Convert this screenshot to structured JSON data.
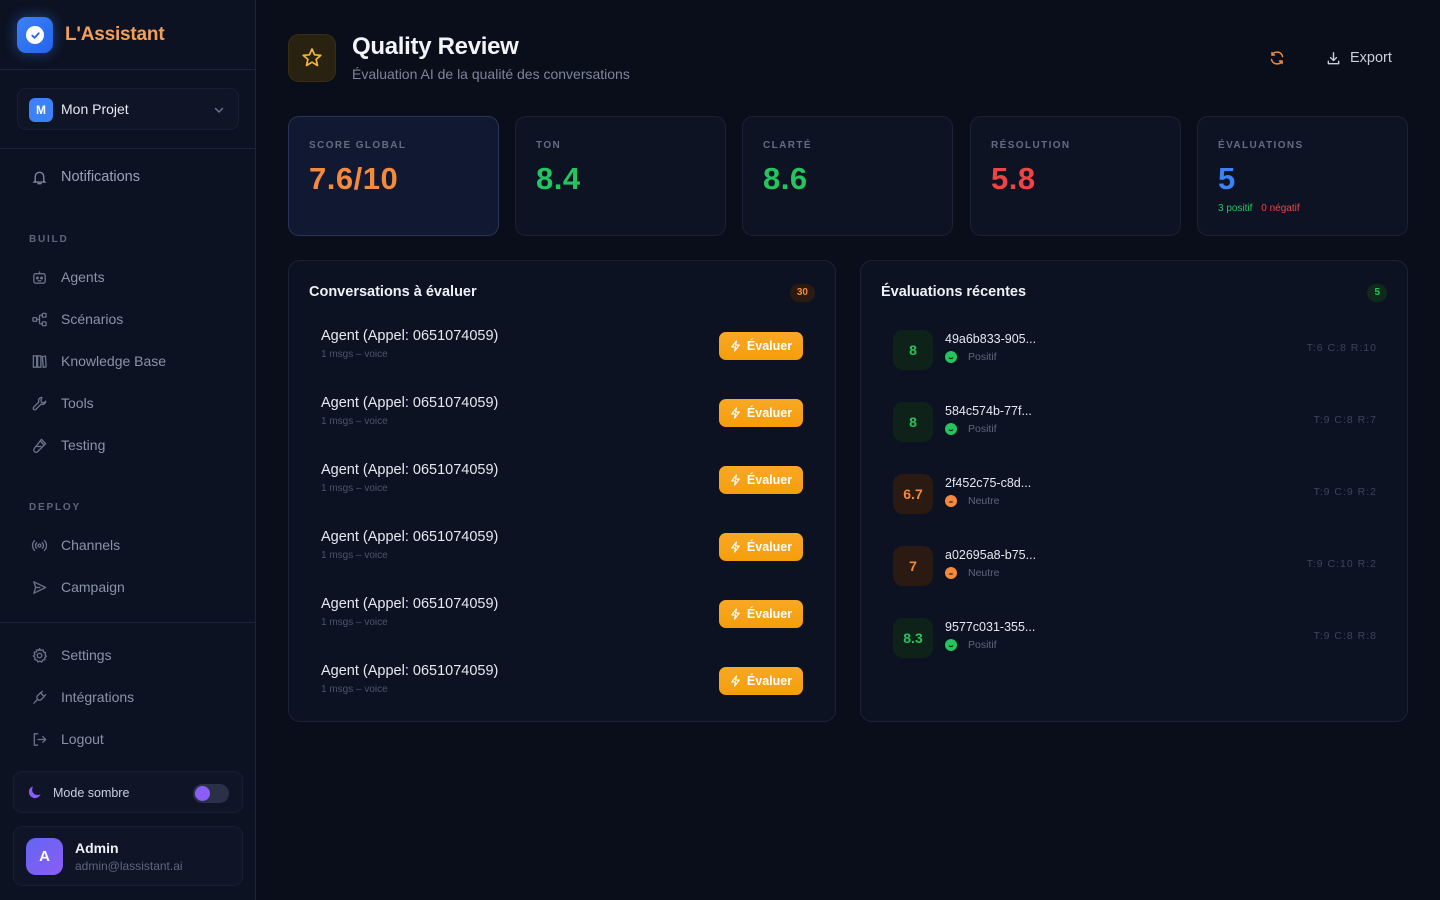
{
  "brand": {
    "name": "L'Assistant"
  },
  "project": {
    "badge": "M",
    "name": "Mon Projet"
  },
  "nav": {
    "notifications": "Notifications",
    "build_label": "BUILD",
    "build": [
      "Agents",
      "Scénarios",
      "Knowledge Base",
      "Tools",
      "Testing"
    ],
    "deploy_label": "DEPLOY",
    "deploy": [
      "Channels",
      "Campaign"
    ],
    "bottom": [
      "Settings",
      "Intégrations",
      "Logout"
    ]
  },
  "mode": {
    "label": "Mode sombre",
    "enabled": true
  },
  "user": {
    "initial": "A",
    "name": "Admin",
    "email": "admin@lassistant.ai"
  },
  "header": {
    "title": "Quality Review",
    "subtitle": "Évaluation AI de la qualité des conversations",
    "export_label": "Export"
  },
  "stats": [
    {
      "label": "SCORE GLOBAL",
      "value": "7.6/10",
      "color": "#f58a3c"
    },
    {
      "label": "TON",
      "value": "8.4",
      "color": "#22c55e"
    },
    {
      "label": "CLARTÉ",
      "value": "8.6",
      "color": "#22c55e"
    },
    {
      "label": "RÉSOLUTION",
      "value": "5.8",
      "color": "#ef4444"
    },
    {
      "label": "ÉVALUATIONS",
      "value": "5",
      "color": "#3b82f6",
      "positive": "3 positif",
      "negative": "0 négatif"
    }
  ],
  "conversations": {
    "title": "Conversations à évaluer",
    "count": "30",
    "button_label": "Évaluer",
    "items": [
      {
        "title": "Agent (Appel: 0651074059)",
        "meta": "1 msgs – voice"
      },
      {
        "title": "Agent (Appel: 0651074059)",
        "meta": "1 msgs – voice"
      },
      {
        "title": "Agent (Appel: 0651074059)",
        "meta": "1 msgs – voice"
      },
      {
        "title": "Agent (Appel: 0651074059)",
        "meta": "1 msgs – voice"
      },
      {
        "title": "Agent (Appel: 0651074059)",
        "meta": "1 msgs – voice"
      },
      {
        "title": "Agent (Appel: 0651074059)",
        "meta": "1 msgs – voice"
      }
    ]
  },
  "recent": {
    "title": "Évaluations récentes",
    "count": "5",
    "items": [
      {
        "score": "8",
        "id": "49a6b833-905...",
        "sentiment": "Positif",
        "tag": "T:6 C:8 R:10",
        "tone": "green"
      },
      {
        "score": "8",
        "id": "584c574b-77f...",
        "sentiment": "Positif",
        "tag": "T:9 C:8 R:7",
        "tone": "green"
      },
      {
        "score": "6.7",
        "id": "2f452c75-c8d...",
        "sentiment": "Neutre",
        "tag": "T:9 C:9 R:2",
        "tone": "orange"
      },
      {
        "score": "7",
        "id": "a02695a8-b75...",
        "sentiment": "Neutre",
        "tag": "T:9 C:10 R:2",
        "tone": "orange"
      },
      {
        "score": "8.3",
        "id": "9577c031-355...",
        "sentiment": "Positif",
        "tag": "T:9 C:8 R:8",
        "tone": "green"
      }
    ]
  }
}
